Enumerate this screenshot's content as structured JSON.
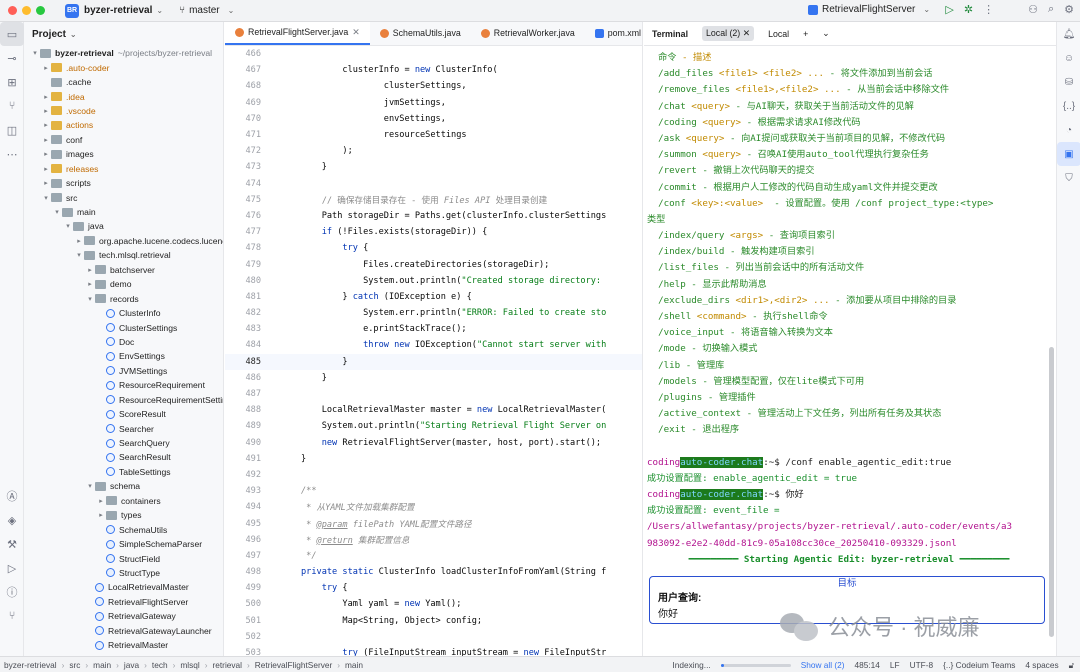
{
  "titlebar": {
    "project_badge": "BR",
    "project_name": "byzer-retrieval",
    "branch": "master",
    "run_config": "RetrievalFlightServer"
  },
  "project_panel": {
    "header": "Project",
    "tree": [
      {
        "label": "byzer-retrieval",
        "extra": "~/projects/byzer-retrieval",
        "depth": 0,
        "arrow": "down",
        "icon": "folder",
        "bold": true
      },
      {
        "label": ".auto-coder",
        "depth": 1,
        "arrow": "right",
        "icon": "folder",
        "orange": true
      },
      {
        "label": ".cache",
        "depth": 1,
        "arrow": "",
        "icon": "folder"
      },
      {
        "label": ".idea",
        "depth": 1,
        "arrow": "right",
        "icon": "folder",
        "orange": true
      },
      {
        "label": ".vscode",
        "depth": 1,
        "arrow": "right",
        "icon": "folder",
        "orange": true
      },
      {
        "label": "actions",
        "depth": 1,
        "arrow": "right",
        "icon": "folder",
        "orange": true
      },
      {
        "label": "conf",
        "depth": 1,
        "arrow": "right",
        "icon": "folder"
      },
      {
        "label": "images",
        "depth": 1,
        "arrow": "right",
        "icon": "folder"
      },
      {
        "label": "releases",
        "depth": 1,
        "arrow": "right",
        "icon": "folder",
        "orange": true
      },
      {
        "label": "scripts",
        "depth": 1,
        "arrow": "right",
        "icon": "folder"
      },
      {
        "label": "src",
        "depth": 1,
        "arrow": "down",
        "icon": "folder"
      },
      {
        "label": "main",
        "depth": 2,
        "arrow": "down",
        "icon": "folder"
      },
      {
        "label": "java",
        "depth": 3,
        "arrow": "down",
        "icon": "folder"
      },
      {
        "label": "org.apache.lucene.codecs.lucene",
        "depth": 4,
        "arrow": "right",
        "icon": "pkg"
      },
      {
        "label": "tech.mlsql.retrieval",
        "depth": 4,
        "arrow": "down",
        "icon": "pkg"
      },
      {
        "label": "batchserver",
        "depth": 5,
        "arrow": "right",
        "icon": "pkg"
      },
      {
        "label": "demo",
        "depth": 5,
        "arrow": "right",
        "icon": "pkg"
      },
      {
        "label": "records",
        "depth": 5,
        "arrow": "down",
        "icon": "pkg"
      },
      {
        "label": "ClusterInfo",
        "depth": 6,
        "arrow": "",
        "icon": "rec"
      },
      {
        "label": "ClusterSettings",
        "depth": 6,
        "arrow": "",
        "icon": "rec"
      },
      {
        "label": "Doc",
        "depth": 6,
        "arrow": "",
        "icon": "rec"
      },
      {
        "label": "EnvSettings",
        "depth": 6,
        "arrow": "",
        "icon": "rec"
      },
      {
        "label": "JVMSettings",
        "depth": 6,
        "arrow": "",
        "icon": "rec"
      },
      {
        "label": "ResourceRequirement",
        "depth": 6,
        "arrow": "",
        "icon": "rec"
      },
      {
        "label": "ResourceRequirementSettin",
        "depth": 6,
        "arrow": "",
        "icon": "rec"
      },
      {
        "label": "ScoreResult",
        "depth": 6,
        "arrow": "",
        "icon": "rec"
      },
      {
        "label": "Searcher",
        "depth": 6,
        "arrow": "",
        "icon": "rec"
      },
      {
        "label": "SearchQuery",
        "depth": 6,
        "arrow": "",
        "icon": "rec"
      },
      {
        "label": "SearchResult",
        "depth": 6,
        "arrow": "",
        "icon": "rec"
      },
      {
        "label": "TableSettings",
        "depth": 6,
        "arrow": "",
        "icon": "rec"
      },
      {
        "label": "schema",
        "depth": 5,
        "arrow": "down",
        "icon": "pkg"
      },
      {
        "label": "containers",
        "depth": 6,
        "arrow": "right",
        "icon": "pkg"
      },
      {
        "label": "types",
        "depth": 6,
        "arrow": "right",
        "icon": "pkg"
      },
      {
        "label": "SchemaUtils",
        "depth": 6,
        "arrow": "",
        "icon": "cls"
      },
      {
        "label": "SimpleSchemaParser",
        "depth": 6,
        "arrow": "",
        "icon": "cls"
      },
      {
        "label": "StructField",
        "depth": 6,
        "arrow": "",
        "icon": "cls"
      },
      {
        "label": "StructType",
        "depth": 6,
        "arrow": "",
        "icon": "cls"
      },
      {
        "label": "LocalRetrievalMaster",
        "depth": 5,
        "arrow": "",
        "icon": "cls"
      },
      {
        "label": "RetrievalFlightServer",
        "depth": 5,
        "arrow": "",
        "icon": "cls"
      },
      {
        "label": "RetrievalGateway",
        "depth": 5,
        "arrow": "",
        "icon": "cls"
      },
      {
        "label": "RetrievalGatewayLauncher",
        "depth": 5,
        "arrow": "",
        "icon": "cls"
      },
      {
        "label": "RetrievalMaster",
        "depth": 5,
        "arrow": "",
        "icon": "cls"
      }
    ]
  },
  "editor": {
    "tabs": [
      {
        "label": "RetrievalFlightServer.java",
        "active": true,
        "kind": "java",
        "closable": true
      },
      {
        "label": "SchemaUtils.java",
        "active": false,
        "kind": "java",
        "closable": false
      },
      {
        "label": "RetrievalWorker.java",
        "active": false,
        "kind": "java",
        "closable": false
      },
      {
        "label": "pom.xml",
        "active": false,
        "kind": "xml",
        "closable": false
      }
    ],
    "lines": [
      {
        "n": "466",
        "html": ""
      },
      {
        "n": "467",
        "html": "        clusterInfo = <span class=\"kw\">new</span> ClusterInfo("
      },
      {
        "n": "468",
        "html": "                clusterSettings,"
      },
      {
        "n": "469",
        "html": "                jvmSettings,"
      },
      {
        "n": "470",
        "html": "                envSettings,"
      },
      {
        "n": "471",
        "html": "                resourceSettings"
      },
      {
        "n": "472",
        "html": "        );"
      },
      {
        "n": "473",
        "html": "    }"
      },
      {
        "n": "474",
        "html": ""
      },
      {
        "n": "475",
        "html": "    <span class=\"cmt\">// 确保存储目录存在 - 使用 <i>Files API</i> 处理目录创建</span>"
      },
      {
        "n": "476",
        "html": "    Path storageDir = Paths.get(clusterInfo.clusterSettings"
      },
      {
        "n": "477",
        "html": "    <span class=\"kw\">if</span> (!Files.exists(storageDir)) {"
      },
      {
        "n": "478",
        "html": "        <span class=\"kw\">try</span> {"
      },
      {
        "n": "479",
        "html": "            Files.createDirectories(storageDir);"
      },
      {
        "n": "480",
        "html": "            System.out.println(<span class=\"str\">\"Created storage directory: </span>"
      },
      {
        "n": "481",
        "html": "        } <span class=\"kw\">catch</span> (IOException e) {"
      },
      {
        "n": "482",
        "html": "            System.err.println(<span class=\"str\">\"ERROR: Failed to create sto</span>"
      },
      {
        "n": "483",
        "html": "            e.printStackTrace();"
      },
      {
        "n": "484",
        "html": "            <span class=\"kw\">throw new</span> IOException(<span class=\"str\">\"Cannot start server with</span>"
      },
      {
        "n": "485",
        "html": "        }",
        "current": true
      },
      {
        "n": "486",
        "html": "    }"
      },
      {
        "n": "487",
        "html": ""
      },
      {
        "n": "488",
        "html": "    LocalRetrievalMaster master = <span class=\"kw\">new</span> LocalRetrievalMaster("
      },
      {
        "n": "489",
        "html": "    System.out.println(<span class=\"str\">\"Starting Retrieval Flight Server on</span>"
      },
      {
        "n": "490",
        "html": "    <span class=\"kw\">new</span> RetrievalFlightServer(master, host, port).start();"
      },
      {
        "n": "491",
        "html": "}"
      },
      {
        "n": "492",
        "html": ""
      },
      {
        "n": "493",
        "html": "<span class=\"cm\">/**</span>"
      },
      {
        "n": "494",
        "html": "<span class=\"cm\"> * 从YAML文件加载集群配置</span>"
      },
      {
        "n": "495",
        "html": "<span class=\"cm\"> * <u>@param</u> filePath YAML配置文件路径</span>"
      },
      {
        "n": "496",
        "html": "<span class=\"cm\"> * <u>@return</u> 集群配置信息</span>"
      },
      {
        "n": "497",
        "html": "<span class=\"cm\"> */</span>"
      },
      {
        "n": "498",
        "html": "<span class=\"kw\">private static</span> ClusterInfo loadClusterInfoFromYaml(String f"
      },
      {
        "n": "499",
        "html": "    <span class=\"kw\">try</span> {"
      },
      {
        "n": "500",
        "html": "        Yaml yaml = <span class=\"kw\">new</span> Yaml();"
      },
      {
        "n": "501",
        "html": "        Map&lt;String, Object&gt; config;"
      },
      {
        "n": "502",
        "html": ""
      },
      {
        "n": "503",
        "html": "        <span class=\"kw\">try</span> (FileInputStream inputStream = <span class=\"kw\">new</span> FileInputStr"
      }
    ]
  },
  "terminal": {
    "title": "Terminal",
    "tabs": [
      "Local (2)",
      "Local"
    ],
    "help_lines": [
      {
        "cmd": "命令",
        "arg": "",
        "desc": " - 描述",
        "desc_is_arg": true
      },
      {
        "cmd": "/add_files",
        "arg": " <file1> <file2> ...",
        "desc": " - 将文件添加到当前会话"
      },
      {
        "cmd": "/remove_files",
        "arg": " <file1>,<file2> ...",
        "desc": " - 从当前会话中移除文件"
      },
      {
        "cmd": "/chat",
        "arg": " <query>",
        "desc": " - 与AI聊天，获取关于当前活动文件的见解"
      },
      {
        "cmd": "/coding",
        "arg": " <query>",
        "desc": " - 根据需求请求AI修改代码"
      },
      {
        "cmd": "/ask",
        "arg": " <query>",
        "desc": " - 向AI提问或获取关于当前项目的见解，不修改代码"
      },
      {
        "cmd": "/summon",
        "arg": " <query>",
        "desc": " - 召唤AI使用auto_tool代理执行复杂任务"
      },
      {
        "cmd": "/revert",
        "arg": "",
        "desc": " - 撤销上次代码聊天的提交"
      },
      {
        "cmd": "/commit",
        "arg": "",
        "desc": " - 根据用户人工修改的代码自动生成yaml文件并提交更改"
      },
      {
        "cmd": "/conf",
        "arg": " <key>:<value>",
        "desc": "  - 设置配置。使用 /conf project_type:<type>"
      },
      {
        "cmd": "类型",
        "arg": "",
        "desc": "",
        "wrap": true
      },
      {
        "cmd": "/index/query",
        "arg": " <args>",
        "desc": " - 查询项目索引"
      },
      {
        "cmd": "/index/build",
        "arg": "",
        "desc": " - 触发构建项目索引"
      },
      {
        "cmd": "/list_files",
        "arg": "",
        "desc": " - 列出当前会话中的所有活动文件"
      },
      {
        "cmd": "/help",
        "arg": "",
        "desc": " - 显示此帮助消息"
      },
      {
        "cmd": "/exclude_dirs",
        "arg": " <dir1>,<dir2> ...",
        "desc": " - 添加要从项目中排除的目录"
      },
      {
        "cmd": "/shell",
        "arg": " <command>",
        "desc": " - 执行shell命令"
      },
      {
        "cmd": "/voice_input",
        "arg": "",
        "desc": " - 将语音输入转换为文本"
      },
      {
        "cmd": "/mode",
        "arg": "",
        "desc": " - 切换输入模式"
      },
      {
        "cmd": "/lib",
        "arg": "",
        "desc": " - 管理库"
      },
      {
        "cmd": "/models",
        "arg": "",
        "desc": " - 管理模型配置，仅在lite模式下可用"
      },
      {
        "cmd": "/plugins",
        "arg": "",
        "desc": " - 管理插件"
      },
      {
        "cmd": "/active_context",
        "arg": "",
        "desc": " - 管理活动上下文任务，列出所有任务及其状态"
      },
      {
        "cmd": "/exit",
        "arg": "",
        "desc": " - 退出程序"
      }
    ],
    "session": [
      {
        "type": "prompt",
        "user": "coding",
        "host": "auto-coder.chat",
        "path": ":~$ ",
        "cmd": "/conf enable_agentic_edit:true"
      },
      {
        "type": "ok",
        "text": "成功设置配置: enable_agentic_edit = true"
      },
      {
        "type": "prompt",
        "user": "coding",
        "host": "auto-coder.chat",
        "path": ":~$ ",
        "cmd": "你好"
      },
      {
        "type": "ok",
        "text": "成功设置配置: event_file ="
      },
      {
        "type": "path",
        "text": "/Users/allwefantasy/projects/byzer-retrieval/.auto-coder/events/a3"
      },
      {
        "type": "path",
        "text": "983092-e2e2-40dd-81c9-05a108cc30ce_20250410-093329.jsonl"
      }
    ],
    "banner": "Starting Agentic Edit: byzer-retrieval",
    "goal_box": {
      "title": "目标",
      "label": "用户查询:",
      "query": "你好"
    }
  },
  "statusbar": {
    "crumbs": [
      "byzer-retrieval",
      "src",
      "main",
      "java",
      "tech",
      "mlsql",
      "retrieval",
      "RetrievalFlightServer",
      "main"
    ],
    "indexing": "Indexing...",
    "indexing_progress": 0.05,
    "show_all": "Show all (2)",
    "position": "485:14",
    "line_sep": "LF",
    "encoding": "UTF-8",
    "plugin": "Codeium Teams",
    "indent": "4 spaces"
  },
  "watermark": {
    "text": "公众号 · 祝威廉"
  },
  "colors": {
    "accent": "#3574f0",
    "terminal_green": "#2a8a2a",
    "terminal_arg": "#c18a00",
    "path_magenta": "#b1108d",
    "box_blue": "#2a4fd1"
  }
}
